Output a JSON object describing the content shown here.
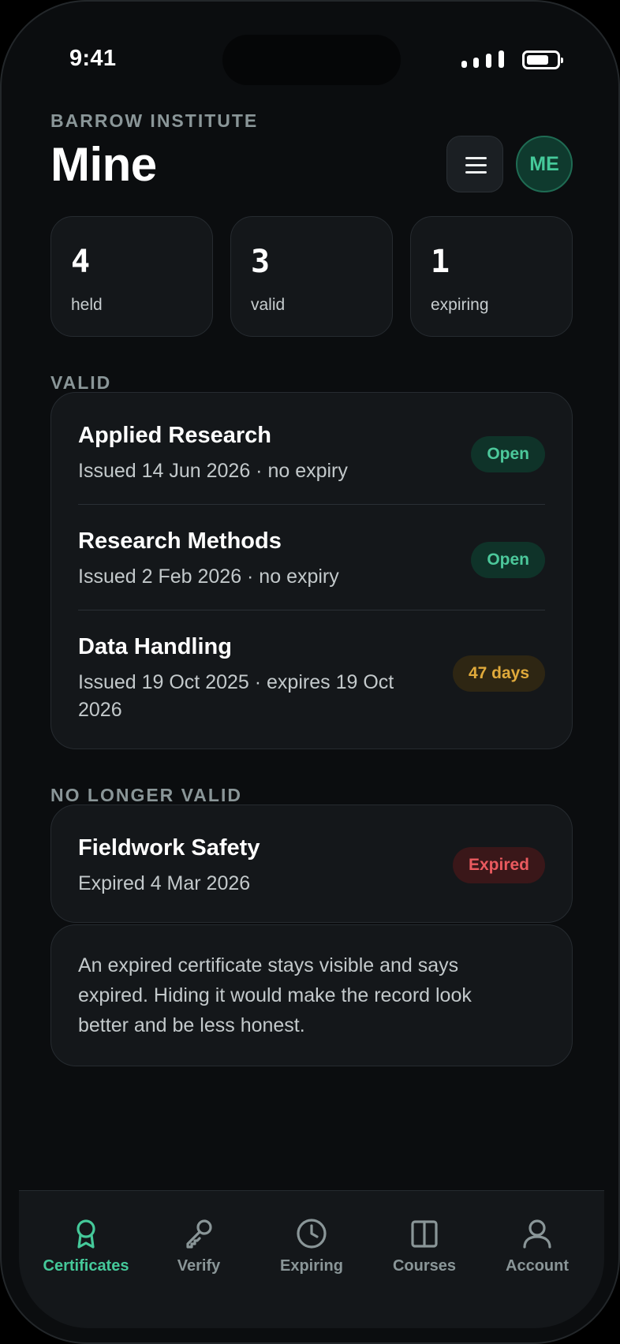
{
  "status_bar": {
    "time": "9:41",
    "battery_level": 0.75
  },
  "header": {
    "org": "BARROW INSTITUTE",
    "title": "Mine",
    "menu_icon": "hamburger-icon",
    "avatar_initials": "ME"
  },
  "stats": [
    {
      "value": "4",
      "label": "held"
    },
    {
      "value": "3",
      "label": "valid"
    },
    {
      "value": "1",
      "label": "expiring"
    }
  ],
  "sections": {
    "valid": {
      "label": "VALID",
      "items": [
        {
          "name": "Applied Research",
          "meta": "Issued 14 Jun 2026 · no expiry",
          "badge": "Open",
          "badge_kind": "open"
        },
        {
          "name": "Research Methods",
          "meta": "Issued 2 Feb 2026 · no expiry",
          "badge": "Open",
          "badge_kind": "open"
        },
        {
          "name": "Data Handling",
          "meta": "Issued 19 Oct 2025 · expires 19 Oct 2026",
          "badge": "47 days",
          "badge_kind": "warn"
        }
      ]
    },
    "invalid": {
      "label": "NO LONGER VALID",
      "items": [
        {
          "name": "Fieldwork Safety",
          "meta": "Expired 4 Mar 2026",
          "badge": "Expired",
          "badge_kind": "expired"
        }
      ]
    }
  },
  "note": "An expired certificate stays visible and says expired. Hiding it would make the record look better and be less honest.",
  "tabs": [
    {
      "label": "Certificates",
      "icon": "award-icon",
      "active": true
    },
    {
      "label": "Verify",
      "icon": "key-icon",
      "active": false
    },
    {
      "label": "Expiring",
      "icon": "clock-icon",
      "active": false
    },
    {
      "label": "Courses",
      "icon": "book-icon",
      "active": false
    },
    {
      "label": "Account",
      "icon": "user-icon",
      "active": false
    }
  ],
  "colors": {
    "accent": "#45c99a",
    "warning": "#e0aa3b",
    "danger": "#ea5a5f",
    "background": "#0b0d0f",
    "card": "#14171a"
  }
}
